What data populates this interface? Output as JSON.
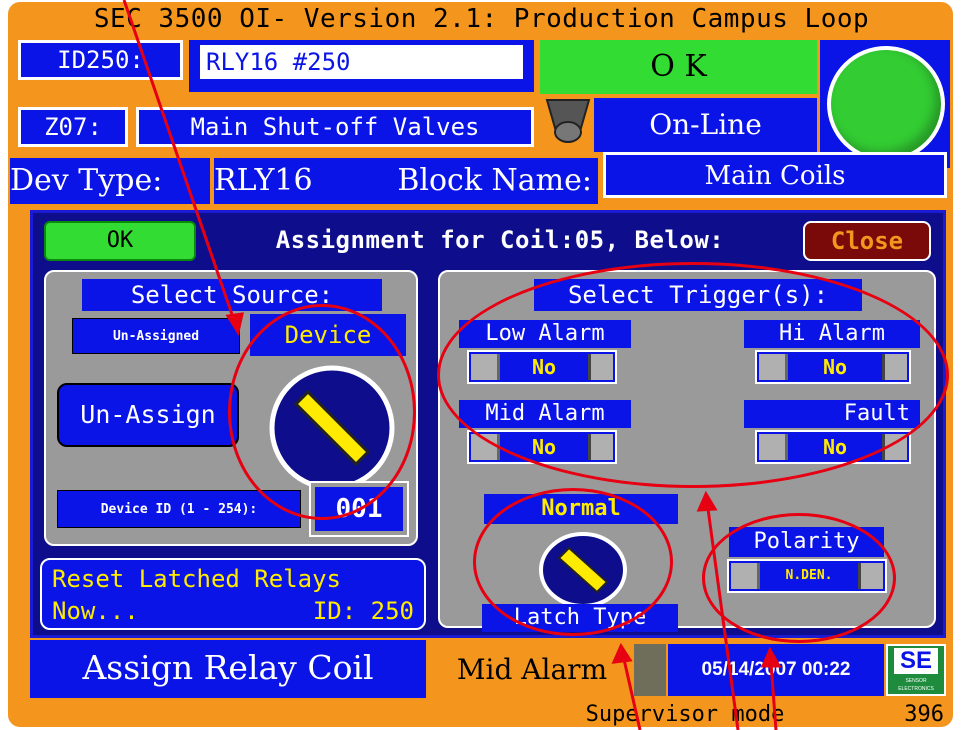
{
  "title": "SEC 3500 OI- Version 2.1: Production Campus Loop",
  "header": {
    "id_label": "ID250:",
    "id_value": "RLY16 #250",
    "zone_label": "Z07:",
    "zone_value": "Main Shut-off Valves",
    "status_ok": "O K",
    "status_online": "On-Line",
    "dev_type_label": "Dev Type:",
    "dev_type_value": "RLY16",
    "block_name_label": "Block Name:",
    "block_name_value": "Main Coils"
  },
  "dialog": {
    "ok_label": "OK",
    "heading": "Assignment for Coil:05, Below:",
    "close_label": "Close",
    "source": {
      "heading": "Select Source:",
      "unassigned_label": "Un-Assigned",
      "device_label": "Device",
      "unassign_button": "Un-Assign",
      "device_id_label": "Device ID (1 - 254):",
      "device_id_value": "001"
    },
    "reset": {
      "line1": "Reset Latched Relays",
      "line2": "Now...",
      "id_text": "ID: 250"
    },
    "triggers": {
      "heading": "Select Trigger(s):",
      "low_alarm_label": "Low Alarm",
      "low_alarm_value": "No",
      "hi_alarm_label": "Hi Alarm",
      "hi_alarm_value": "No",
      "mid_alarm_label": "Mid Alarm",
      "mid_alarm_value": "No",
      "fault_label": "Fault",
      "fault_value": "No"
    },
    "latch": {
      "mode_label": "Normal",
      "type_label": "Latch Type"
    },
    "polarity": {
      "label": "Polarity",
      "value": "N.DEN."
    }
  },
  "footer": {
    "screen_name": "Assign Relay Coil",
    "alarm_text": "Mid Alarm",
    "datetime": "05/14/2007 00:22",
    "logo_text": "SE",
    "logo_subtext": "SENSOR ELECTRONICS",
    "mode_text": "Supervisor mode",
    "screen_number": "396"
  },
  "colors": {
    "frame": "#F4961E",
    "primary_blue": "#0A14E6",
    "ok_green": "#32DC32",
    "close_red": "#7A0A0A",
    "switch_text": "#FFEB00",
    "annotation_red": "#E60012"
  }
}
